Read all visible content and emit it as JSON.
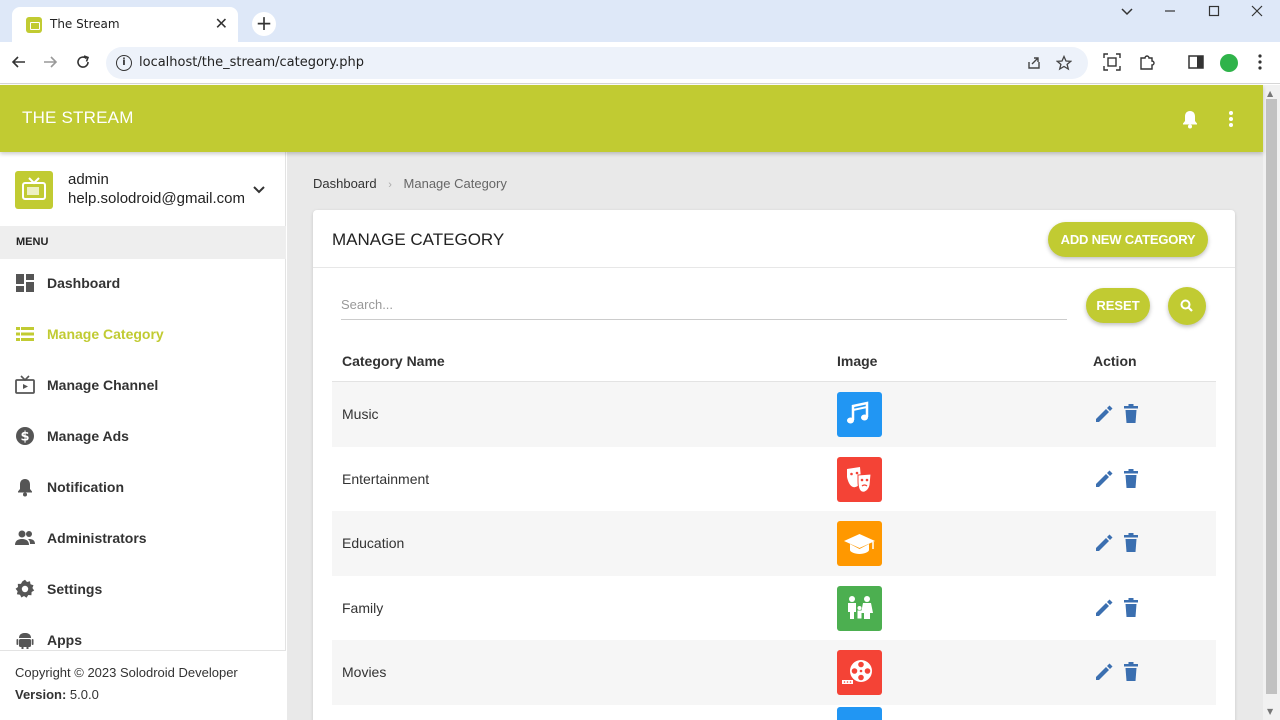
{
  "browser": {
    "tab_title": "The Stream",
    "tab_close": "✕",
    "new_tab": "+",
    "url": "localhost/the_stream/category.php",
    "window_controls": {
      "minimize": "—",
      "maximize": "☐",
      "close": "✕",
      "chevron": "⌄"
    }
  },
  "app": {
    "title": "THE STREAM",
    "brand_color": "#c1cb32"
  },
  "user": {
    "name": "admin",
    "email": "help.solodroid@gmail.com"
  },
  "menu": {
    "header": "MENU",
    "items": [
      {
        "label": "Dashboard",
        "icon": "dashboard-icon",
        "active": false
      },
      {
        "label": "Manage Category",
        "icon": "list-icon",
        "active": true
      },
      {
        "label": "Manage Channel",
        "icon": "tv-icon",
        "active": false
      },
      {
        "label": "Manage Ads",
        "icon": "dollar-icon",
        "active": false
      },
      {
        "label": "Notification",
        "icon": "bell-icon",
        "active": false
      },
      {
        "label": "Administrators",
        "icon": "people-icon",
        "active": false
      },
      {
        "label": "Settings",
        "icon": "gear-icon",
        "active": false
      },
      {
        "label": "Apps",
        "icon": "android-icon",
        "active": false
      }
    ]
  },
  "footer": {
    "copyright": "Copyright © 2023 Solodroid Developer",
    "version_label": "Version:",
    "version_value": "5.0.0"
  },
  "breadcrumb": {
    "items": [
      "Dashboard",
      "Manage Category"
    ],
    "separator": "›"
  },
  "card": {
    "title": "MANAGE CATEGORY",
    "add_button": "ADD NEW CATEGORY",
    "search_placeholder": "Search...",
    "reset_button": "RESET"
  },
  "table": {
    "headers": [
      "Category Name",
      "Image",
      "Action"
    ],
    "rows": [
      {
        "name": "Music",
        "icon": "music-icon",
        "color": "#2196f3"
      },
      {
        "name": "Entertainment",
        "icon": "theater-masks-icon",
        "color": "#f44336"
      },
      {
        "name": "Education",
        "icon": "graduation-cap-icon",
        "color": "#ff9800"
      },
      {
        "name": "Family",
        "icon": "family-icon",
        "color": "#4caf50"
      },
      {
        "name": "Movies",
        "icon": "film-reel-icon",
        "color": "#f44336"
      }
    ],
    "action_color": "#3b6fb0"
  }
}
